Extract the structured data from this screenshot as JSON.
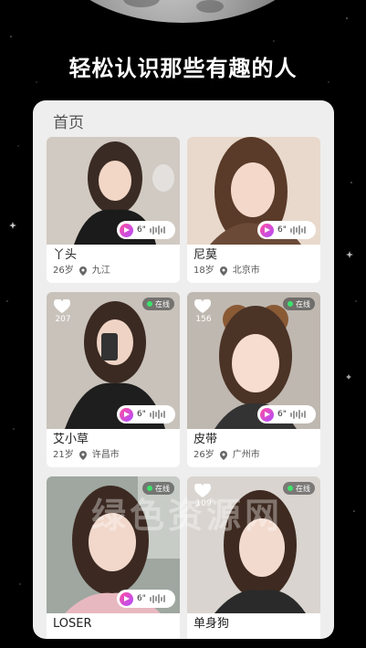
{
  "headline": "轻松认识那些有趣的人",
  "panel": {
    "title": "首页"
  },
  "watermark": "绿色资源网",
  "colors": {
    "accent_gradient_start": "#ff4fa0",
    "accent_gradient_end": "#b04cff",
    "online_dot": "#3ce36b"
  },
  "cards": [
    {
      "name": "丫头",
      "age": "26岁",
      "city": "九江",
      "voice_duration": "6\"",
      "online": false,
      "likes": null
    },
    {
      "name": "尼莫",
      "age": "18岁",
      "city": "北京市",
      "voice_duration": "6\"",
      "online": false,
      "likes": null
    },
    {
      "name": "艾小草",
      "age": "21岁",
      "city": "许昌市",
      "voice_duration": "6\"",
      "online": true,
      "online_label": "在线",
      "likes": "207"
    },
    {
      "name": "皮带",
      "age": "26岁",
      "city": "广州市",
      "voice_duration": "6\"",
      "online": true,
      "online_label": "在线",
      "likes": "156"
    },
    {
      "name": "LOSER",
      "age": "",
      "city": "",
      "voice_duration": "6\"",
      "online": true,
      "online_label": "在线",
      "likes": ""
    },
    {
      "name": "单身狗",
      "age": "",
      "city": "",
      "voice_duration": "",
      "online": true,
      "online_label": "在线",
      "likes": "109"
    }
  ]
}
